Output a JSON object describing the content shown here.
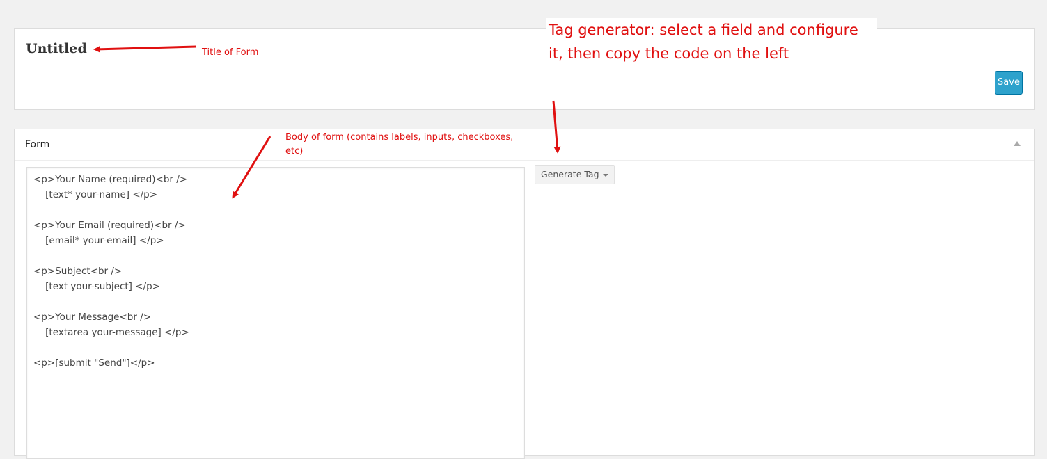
{
  "title_box": {
    "title": "Untitled",
    "save_label": "Save"
  },
  "form_box": {
    "header": "Form",
    "code_lines": [
      "<p>Your Name (required)<br />",
      "    [text* your-name] </p>",
      "",
      "<p>Your Email (required)<br />",
      "    [email* your-email] </p>",
      "",
      "<p>Subject<br />",
      "    [text your-subject] </p>",
      "",
      "<p>Your Message<br />",
      "    [textarea your-message] </p>",
      "",
      "<p>[submit \"Send\"]</p>"
    ],
    "generate_tag_label": "Generate Tag"
  },
  "annotations": {
    "title_note": "Title of Form",
    "body_note": "Body of form (contains labels, inputs, checkboxes, etc)",
    "tag_note": "Tag generator: select a field and configure it, then copy the code on the left"
  },
  "colors": {
    "annotation": "#e01010",
    "save_button": "#2ea2cc",
    "background": "#f1f1f1"
  }
}
